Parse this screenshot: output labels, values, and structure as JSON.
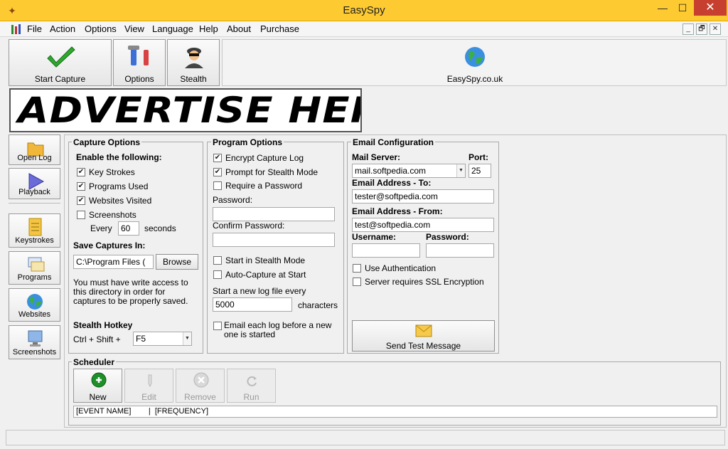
{
  "window": {
    "title": "EasySpy",
    "controls": {
      "minimize": "—",
      "maximize": "☐",
      "close": "✕"
    }
  },
  "menu": {
    "items": [
      "File",
      "Action",
      "Options",
      "View",
      "Language",
      "Help",
      "About",
      "Purchase"
    ],
    "mdi": {
      "minimize": "_",
      "restore": "🗗",
      "close": "✕"
    }
  },
  "toolbar": {
    "start_capture": "Start Capture",
    "options": "Options",
    "stealth": "Stealth",
    "website": "EasySpy.co.uk"
  },
  "banner": {
    "text": "ADVERTISE HERE"
  },
  "sidebar": {
    "open_log": "Open Log",
    "playback": "Playback",
    "keystrokes": "Keystrokes",
    "programs": "Programs",
    "websites": "Websites",
    "screenshots": "Screenshots"
  },
  "capture_options": {
    "title": "Capture Options",
    "enable_label": "Enable the following:",
    "key_strokes": {
      "label": "Key Strokes",
      "checked": true
    },
    "programs_used": {
      "label": "Programs Used",
      "checked": true
    },
    "websites_visited": {
      "label": "Websites Visited",
      "checked": true
    },
    "screenshots": {
      "label": "Screenshots",
      "checked": false
    },
    "every_label": "Every",
    "every_value": "60",
    "seconds_label": "seconds",
    "save_label": "Save Captures In:",
    "save_path": "C:\\Program Files (",
    "browse": "Browse",
    "note_line1": "You must have write access to",
    "note_line2": "this directory in order for",
    "note_line3": "captures to be properly saved.",
    "hotkey_label": "Stealth Hotkey",
    "hotkey_prefix": "Ctrl + Shift +",
    "hotkey_value": "F5"
  },
  "program_options": {
    "title": "Program Options",
    "encrypt": {
      "label": "Encrypt Capture Log",
      "checked": true
    },
    "prompt_stealth": {
      "label": "Prompt for Stealth Mode",
      "checked": true
    },
    "require_password": {
      "label": "Require a Password",
      "checked": false
    },
    "password_label": "Password:",
    "password_value": "",
    "confirm_label": "Confirm Password:",
    "confirm_value": "",
    "start_stealth": {
      "label": "Start in Stealth Mode",
      "checked": false
    },
    "auto_capture": {
      "label": "Auto-Capture at Start",
      "checked": false
    },
    "newlog_label": "Start a new log file every",
    "newlog_value": "5000",
    "characters_label": "characters",
    "email_each": {
      "label_line1": "Email each log before a new",
      "label_line2": "one is started",
      "checked": false
    }
  },
  "email_config": {
    "title": "Email Configuration",
    "mail_server_label": "Mail Server:",
    "mail_server_value": "mail.softpedia.com",
    "port_label": "Port:",
    "port_value": "25",
    "to_label": "Email Address - To:",
    "to_value": "tester@softpedia.com",
    "from_label": "Email Address - From:",
    "from_value": "test@softpedia.com",
    "username_label": "Username:",
    "username_value": "",
    "password_label": "Password:",
    "password_value": "",
    "use_auth": {
      "label": "Use Authentication",
      "checked": false
    },
    "ssl": {
      "label": "Server requires SSL Encryption",
      "checked": false
    },
    "send_test": "Send Test Message"
  },
  "scheduler": {
    "title": "Scheduler",
    "new": "New",
    "edit": "Edit",
    "remove": "Remove",
    "run": "Run",
    "header": "[EVENT NAME]        |  [FREQUENCY]"
  },
  "colors": {
    "titlebar": "#fdca32",
    "close_button": "#c7402f",
    "check_green": "#2fa82f"
  }
}
